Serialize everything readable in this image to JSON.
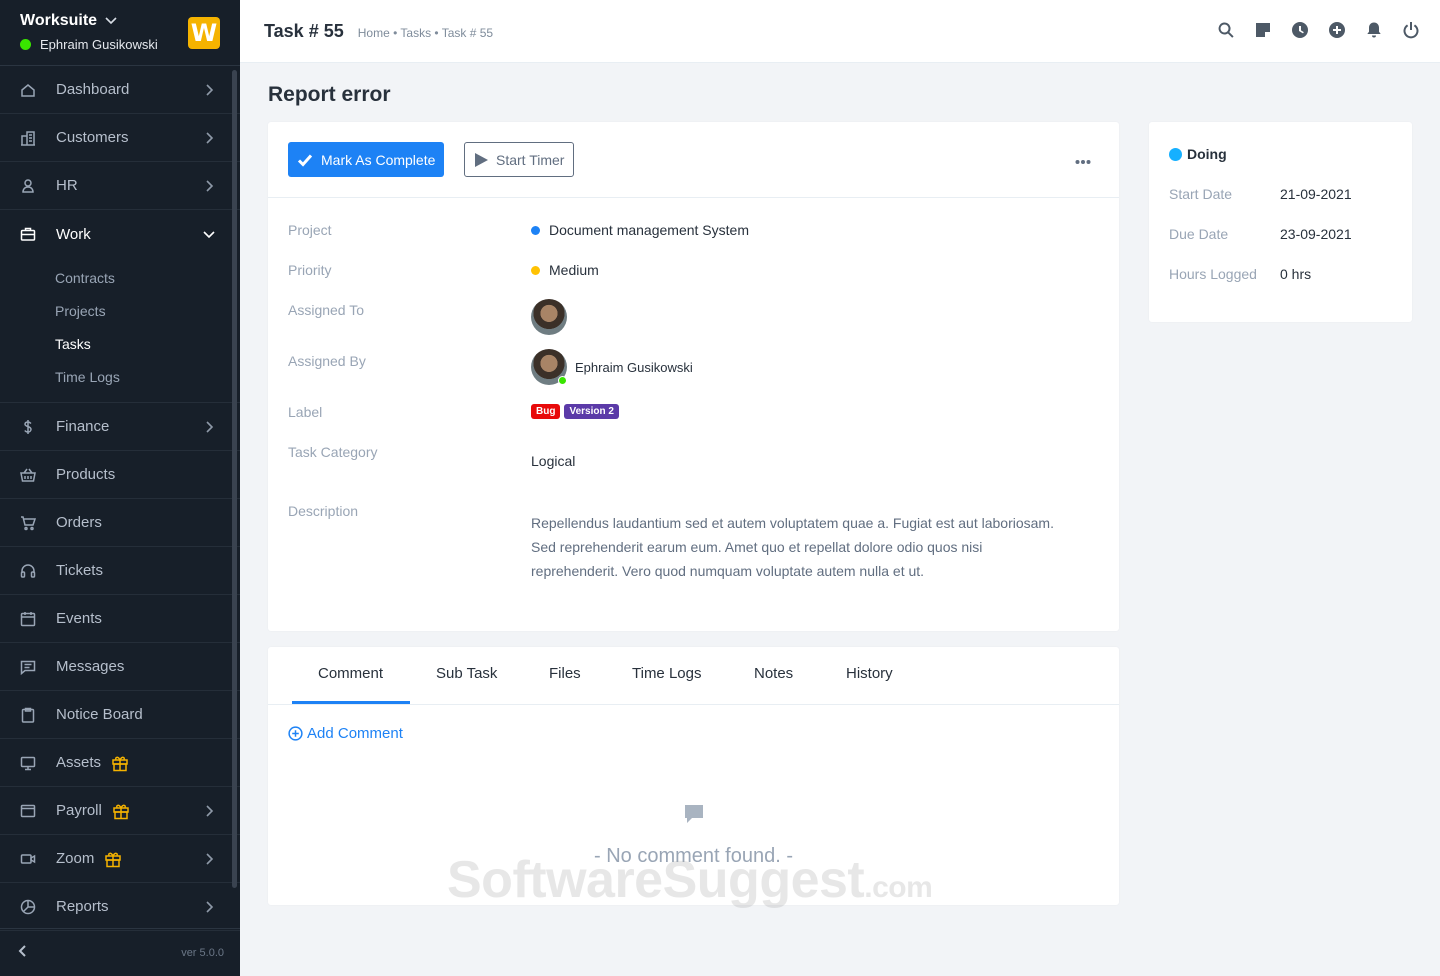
{
  "sidebar": {
    "brand": "Worksuite",
    "user": "Ephraim Gusikowski",
    "logo_letter": "W",
    "items": [
      {
        "label": "Dashboard",
        "icon": "house-icon",
        "arrow": true
      },
      {
        "label": "Customers",
        "icon": "building-icon",
        "arrow": true
      },
      {
        "label": "HR",
        "icon": "person-icon",
        "arrow": true
      },
      {
        "label": "Work",
        "icon": "briefcase-icon",
        "expanded": true
      },
      {
        "label": "Finance",
        "icon": "dollar-icon",
        "arrow": true
      },
      {
        "label": "Products",
        "icon": "basket-icon"
      },
      {
        "label": "Orders",
        "icon": "cart-icon"
      },
      {
        "label": "Tickets",
        "icon": "headset-icon"
      },
      {
        "label": "Events",
        "icon": "calendar-icon"
      },
      {
        "label": "Messages",
        "icon": "chat-icon"
      },
      {
        "label": "Notice Board",
        "icon": "clipboard-icon"
      },
      {
        "label": "Assets",
        "icon": "monitor-icon",
        "gift": true
      },
      {
        "label": "Payroll",
        "icon": "wallet-icon",
        "gift": true,
        "arrow": true
      },
      {
        "label": "Zoom",
        "icon": "camera-icon",
        "gift": true,
        "arrow": true
      },
      {
        "label": "Reports",
        "icon": "piechart-icon",
        "arrow": true
      }
    ],
    "work_sub": [
      "Contracts",
      "Projects",
      "Tasks",
      "Time Logs"
    ],
    "version": "ver 5.0.0"
  },
  "topbar": {
    "title": "Task # 55",
    "breadcrumb": "Home • Tasks • Task # 55"
  },
  "task": {
    "heading": "Report error",
    "mark_complete": "Mark As Complete",
    "start_timer": "Start Timer",
    "fields": {
      "project_label": "Project",
      "project_value": "Document management System",
      "priority_label": "Priority",
      "priority_value": "Medium",
      "assigned_to_label": "Assigned To",
      "assigned_by_label": "Assigned By",
      "assigned_by_name": "Ephraim Gusikowski",
      "label_label": "Label",
      "labels": [
        "Bug",
        "Version 2"
      ],
      "category_label": "Task Category",
      "category_value": "Logical",
      "description_label": "Description",
      "description": "Repellendus laudantium sed et autem voluptatem quae a. Fugiat est aut laboriosam. Sed reprehenderit earum eum. Amet quo et repellat dolore odio quos nisi reprehenderit. Vero quod numquam voluptate autem nulla et ut."
    },
    "colors": {
      "primary": "#1d82f5",
      "project_dot": "#1d82f5",
      "priority_dot": "#ffc203",
      "bug": "#e80a0a",
      "version": "#5b3aa8",
      "status_dot": "#16b0ff"
    }
  },
  "status": {
    "label": "Doing",
    "start_date_label": "Start Date",
    "start_date": "21-09-2021",
    "due_date_label": "Due Date",
    "due_date": "23-09-2021",
    "hours_label": "Hours Logged",
    "hours": "0 hrs"
  },
  "tabs": {
    "items": [
      "Comment",
      "Sub Task",
      "Files",
      "Time Logs",
      "Notes",
      "History"
    ],
    "active": "Comment",
    "add_comment": "Add Comment",
    "empty": "- No comment found. -"
  },
  "watermark": {
    "main": "SoftwareSuggest",
    "suffix": ".com"
  }
}
